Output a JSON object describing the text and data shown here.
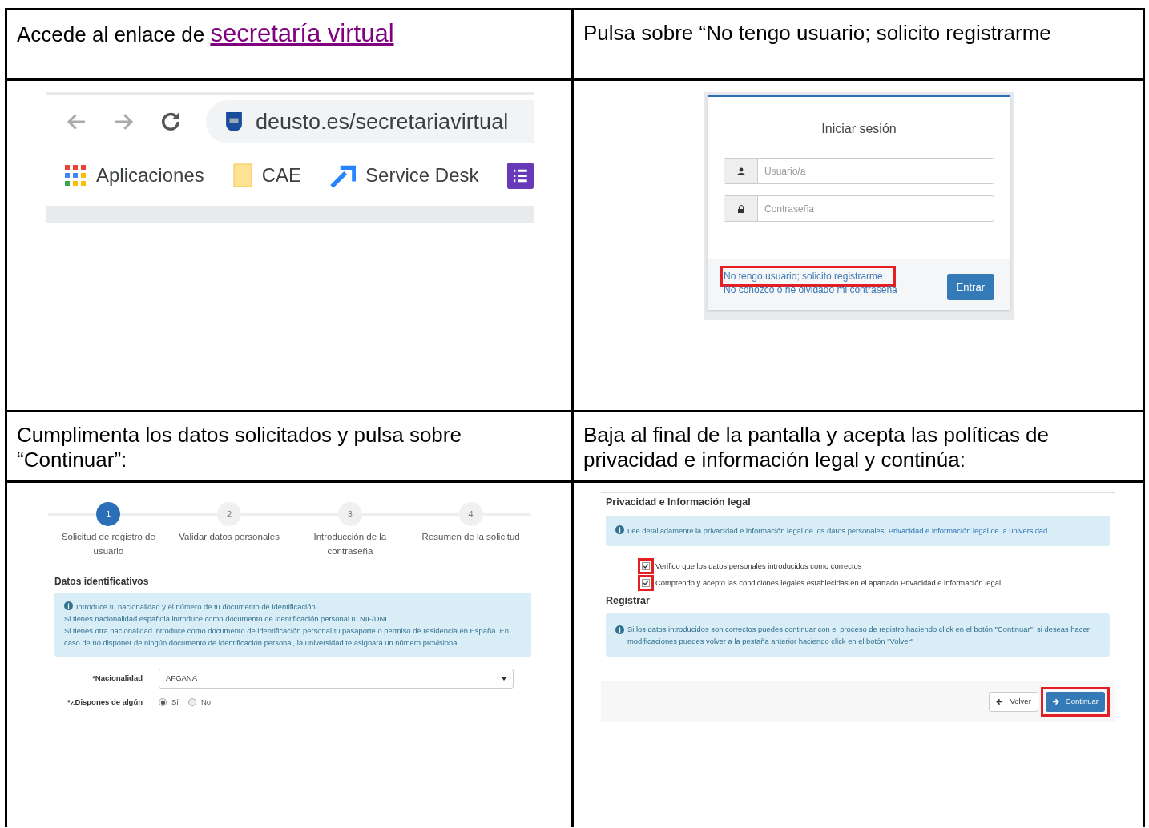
{
  "instructions": [
    {
      "text": "Accede al enlace de ",
      "link": "secretaría virtual"
    },
    {
      "text": "Pulsa sobre “No tengo usuario; solicito registrarme"
    },
    {
      "text": "Cumplimenta los datos solicitados y pulsa sobre “Continuar”:"
    },
    {
      "text": "Baja al final de la pantalla y acepta las políticas de privacidad e información legal y continúa:"
    }
  ],
  "browser": {
    "url": "deusto.es/secretariavirtual",
    "bookmarks": [
      "Aplicaciones",
      "CAE",
      "Service Desk"
    ]
  },
  "login": {
    "title": "Iniciar sesión",
    "user_placeholder": "Usuario/a",
    "password_placeholder": "Contraseña",
    "links": [
      {
        "text": "No tengo usuario; solicito registrarme",
        "highlighted": true
      },
      {
        "text": "No conozco o he olvidado mi contraseña",
        "highlighted": false
      }
    ],
    "button": "Entrar"
  },
  "wizard": {
    "steps": [
      {
        "number": "1",
        "label": "Solicitud de registro de usuario",
        "selected": true
      },
      {
        "number": "2",
        "label": "Validar datos personales",
        "selected": false
      },
      {
        "number": "3",
        "label": "Introducción de la contraseña",
        "selected": false
      },
      {
        "number": "4",
        "label": "Resumen de la solicitud",
        "selected": false
      }
    ],
    "section": "Datos identificativos",
    "info": [
      "Introduce tu nacionalidad y el número de tu documento de identificación.",
      "Si tienes nacionalidad española introduce como documento de identificación personal tu NIF/DNI.",
      "Si tienes otra nacionalidad introduce como documento de identificación personal tu pasaporte o permiso de residencia en España. En caso de no disponer de ningún documento de identificación personal, la universidad te asignará un número provisional"
    ],
    "nationality_label": "*Nacionalidad",
    "nationality_value": "AFGANA",
    "document_label": "*¿Dispones de algún",
    "radios": [
      {
        "label": "Sí",
        "selected": true
      },
      {
        "label": "No",
        "selected": false
      }
    ]
  },
  "privacy": {
    "title": "Privacidad e Información legal",
    "info": "Lee detalladamente la privacidad e información legal de los datos personales: ",
    "info_link": "Privacidad e información legal de la universidad",
    "checks": [
      {
        "label": "Verifico que los datos personales introducidos como correctos",
        "checked": true
      },
      {
        "label": "Comprendo y acepto las condiciones legales establecidas en el apartado Privacidad e información legal",
        "checked": true
      }
    ],
    "register_title": "Registrar",
    "register_info": "Si los datos introducidos son correctos puedes continuar con el proceso de registro haciendo click en el botón \"Continuar\", si deseas hacer modificaciones puedes volver a la pestaña anterior haciendo click en el botón \"Volver\"",
    "back": "Volver",
    "continue": "Continuar",
    "continue_highlighted": true
  }
}
